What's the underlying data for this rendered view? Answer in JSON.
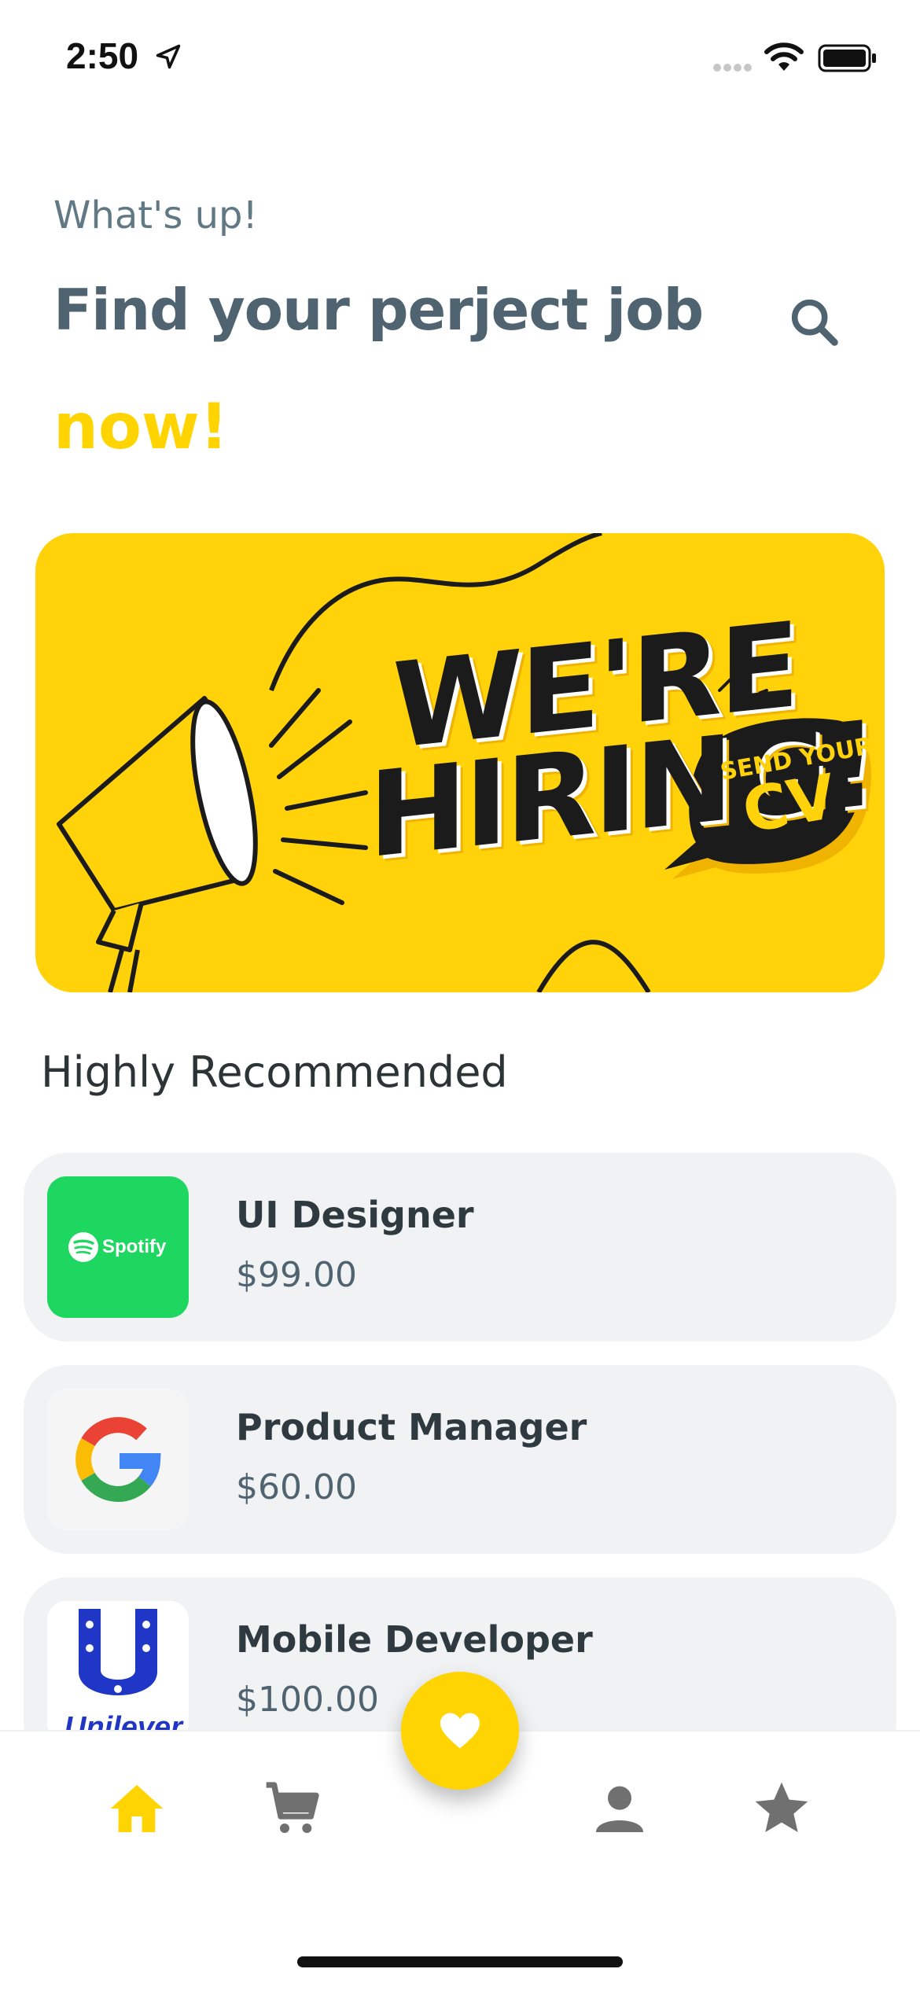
{
  "status_bar": {
    "time": "2:50"
  },
  "header": {
    "greeting": "What's up!",
    "headline": "Find your perject job",
    "accent": "now!"
  },
  "banner": {
    "line1": "WE'RE",
    "line2": "HIRING!",
    "bubble_small": "SEND YOUR",
    "bubble_big": "CV",
    "colors": {
      "background": "#ffd20a",
      "ink": "#1b1b1b"
    }
  },
  "section": {
    "title": "Highly Recommended"
  },
  "jobs": [
    {
      "title": "UI Designer",
      "price": "$99.00",
      "company_logo": "Spotify"
    },
    {
      "title": "Product Manager",
      "price": "$60.00",
      "company_logo": "G"
    },
    {
      "title": "Mobile Developer",
      "price": "$100.00",
      "company_logo": "Unilever"
    }
  ],
  "nav": {
    "items": [
      {
        "icon": "home-icon",
        "active": true
      },
      {
        "icon": "cart-icon",
        "active": false
      },
      {
        "icon": "heart-icon",
        "active": false
      },
      {
        "icon": "person-icon",
        "active": false
      },
      {
        "icon": "star-icon",
        "active": false
      }
    ]
  },
  "theme": {
    "accent": "#ffd400",
    "heading": "#4f6470",
    "card_bg": "#f1f2f3"
  }
}
